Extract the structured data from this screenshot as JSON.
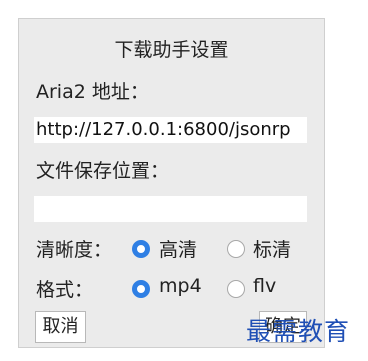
{
  "dialog": {
    "title": "下载助手设置"
  },
  "aria2": {
    "label": "Aria2 地址：",
    "value": "http://127.0.0.1:6800/jsonrp"
  },
  "save_location": {
    "label": "文件保存位置：",
    "value": ""
  },
  "clarity": {
    "label": "清晰度：",
    "options": [
      {
        "label": "高清",
        "selected": true
      },
      {
        "label": "标清",
        "selected": false
      }
    ]
  },
  "format": {
    "label": "格式：",
    "options": [
      {
        "label": "mp4",
        "selected": true
      },
      {
        "label": "flv",
        "selected": false
      }
    ]
  },
  "buttons": {
    "cancel": "取消",
    "confirm": "确定"
  },
  "watermark": "最需教育",
  "colors": {
    "accent": "#2f7fe4",
    "panel_bg": "#ebebeb",
    "watermark": "#1f4fb5"
  }
}
